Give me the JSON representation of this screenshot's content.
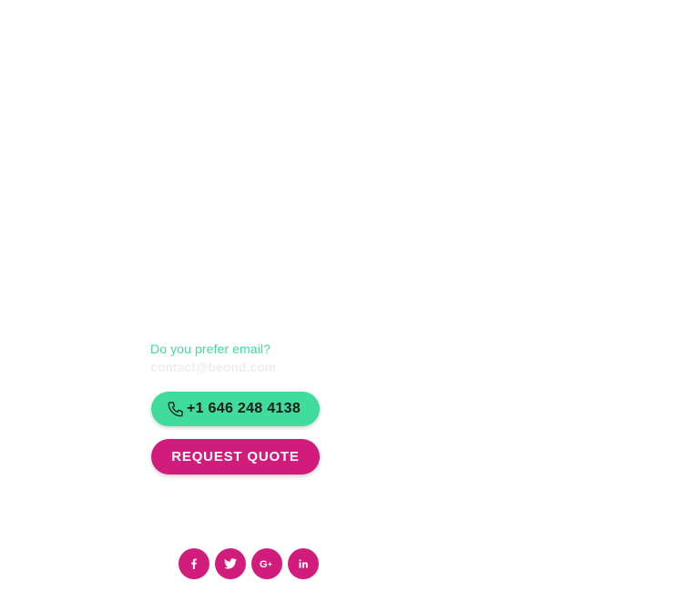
{
  "contact": {
    "email_prompt": "Do you prefer email?",
    "email": "contact@beond.com"
  },
  "phone_button": {
    "label": "+1 646 248 4138",
    "icon": "phone-icon",
    "color": "#3fdc9c"
  },
  "quote_button": {
    "label": "REQUEST QUOTE",
    "color": "#d11c7c"
  },
  "social": {
    "color": "#d11c7c",
    "items": [
      {
        "name": "facebook",
        "icon": "facebook-icon"
      },
      {
        "name": "twitter",
        "icon": "twitter-icon"
      },
      {
        "name": "google-plus",
        "icon": "google-plus-icon"
      },
      {
        "name": "linkedin",
        "icon": "linkedin-icon"
      }
    ]
  }
}
